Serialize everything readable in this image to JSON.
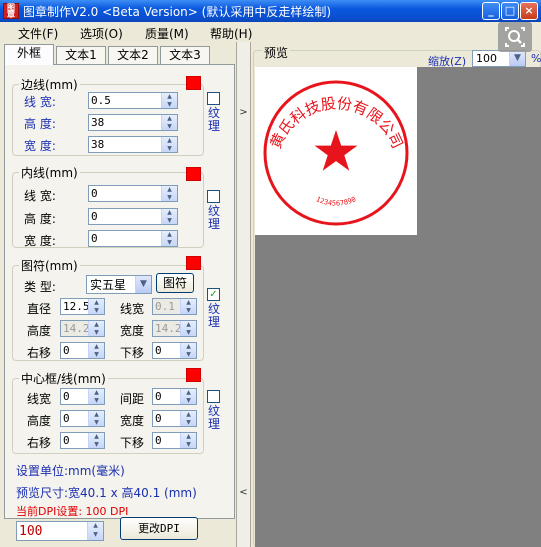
{
  "window": {
    "title": "图章制作V2.0 <Beta Version> (默认采用中反走样绘制)",
    "icon_text": "图章",
    "buttons": {
      "minimize": "_",
      "maximize": "□",
      "close": "×"
    }
  },
  "menu": [
    {
      "label": "文件(F)"
    },
    {
      "label": "选项(O)"
    },
    {
      "label": "质量(M)"
    },
    {
      "label": "帮助(H)"
    }
  ],
  "tabs": [
    {
      "label": "外框",
      "active": true
    },
    {
      "label": "文本1"
    },
    {
      "label": "文本2"
    },
    {
      "label": "文本3"
    }
  ],
  "border_group": {
    "legend": "边线(mm)",
    "line_width_label": "线  宽:",
    "line_width": "0.5",
    "height_label": "高  度:",
    "height": "38",
    "width_label": "宽  度:",
    "width": "38",
    "texture_label": "纹理",
    "texture_checked": false,
    "color": "#ff0000"
  },
  "inner_group": {
    "legend": "内线(mm)",
    "line_width_label": "线  宽:",
    "line_width": "0",
    "height_label": "高  度:",
    "height": "0",
    "width_label": "宽  度:",
    "width": "0",
    "texture_label": "纹理",
    "texture_checked": false,
    "color": "#ff0000"
  },
  "symbol_group": {
    "legend": "图符(mm)",
    "type_label": "类  型:",
    "type_value": "实五星",
    "symbol_button": "图符",
    "diameter_label": "直径",
    "diameter": "12.5",
    "line_width_label": "线宽",
    "line_width": "0.1",
    "height_label": "高度",
    "height": "14.2",
    "width_label": "宽度",
    "width": "14.2",
    "right_shift_label": "右移",
    "right_shift": "0",
    "down_shift_label": "下移",
    "down_shift": "0",
    "texture_label": "纹理",
    "texture_checked": true,
    "color": "#ff0000"
  },
  "center_group": {
    "legend": "中心框/线(mm)",
    "line_width_label": "线宽",
    "line_width": "0",
    "spacing_label": "间距",
    "spacing": "0",
    "height_label": "高度",
    "height": "0",
    "width_label": "宽度",
    "width": "0",
    "right_shift_label": "右移",
    "right_shift": "0",
    "down_shift_label": "下移",
    "down_shift": "0",
    "texture_label": "纹理",
    "texture_checked": false,
    "color": "#ff0000"
  },
  "status": {
    "unit_text": "设置单位:mm(毫米)",
    "preview_size_text": "预览尺寸:宽40.1 x 高40.1 (mm)",
    "dpi_text": "当前DPI设置: 100 DPI",
    "dpi_value": "100",
    "change_dpi_button": "更改DPI"
  },
  "scroll_arrows": {
    "up": "▲",
    "down": "▼",
    "right": ">",
    "left": "<"
  },
  "preview": {
    "legend": "预览",
    "zoom_label": "缩放(Z)",
    "zoom_value": "100",
    "zoom_unit": "%",
    "search_icon": "search-icon"
  },
  "seal": {
    "outer_text": "黄氏科技股份有限公司",
    "number_text": "1234567890",
    "color": "#e8141c"
  }
}
